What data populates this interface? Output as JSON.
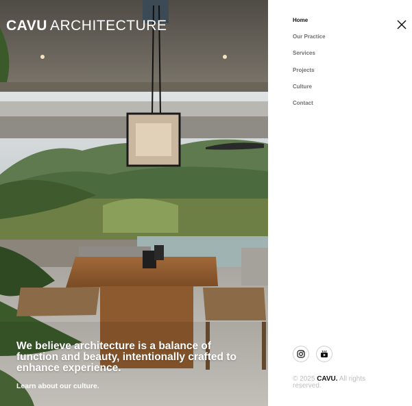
{
  "hero": {
    "logo_bold": "CAVU",
    "logo_light": "ARCHITECTURE",
    "tagline": "We believe architecture is a balance of function and beauty, intentionally crafted to enhance experience.",
    "culture_link": "Learn about our culture."
  },
  "menu": {
    "items": [
      {
        "label": "Home",
        "active": true
      },
      {
        "label": "Our Practice"
      },
      {
        "label": "Services"
      },
      {
        "label": "Projects"
      },
      {
        "label": "Culture"
      },
      {
        "label": "Contact"
      }
    ],
    "close_icon": "close-icon"
  },
  "social": {
    "instagram_icon": "instagram-icon",
    "youtube_icon": "youtube-icon"
  },
  "footer": {
    "copyright_prefix": "© 2025",
    "brand": "CAVU.",
    "copyright_suffix": "All rights reserved."
  },
  "colors": {
    "active_menu": "#111111",
    "menu": "#6f6f6f",
    "copyright": "#bdbdbd"
  }
}
